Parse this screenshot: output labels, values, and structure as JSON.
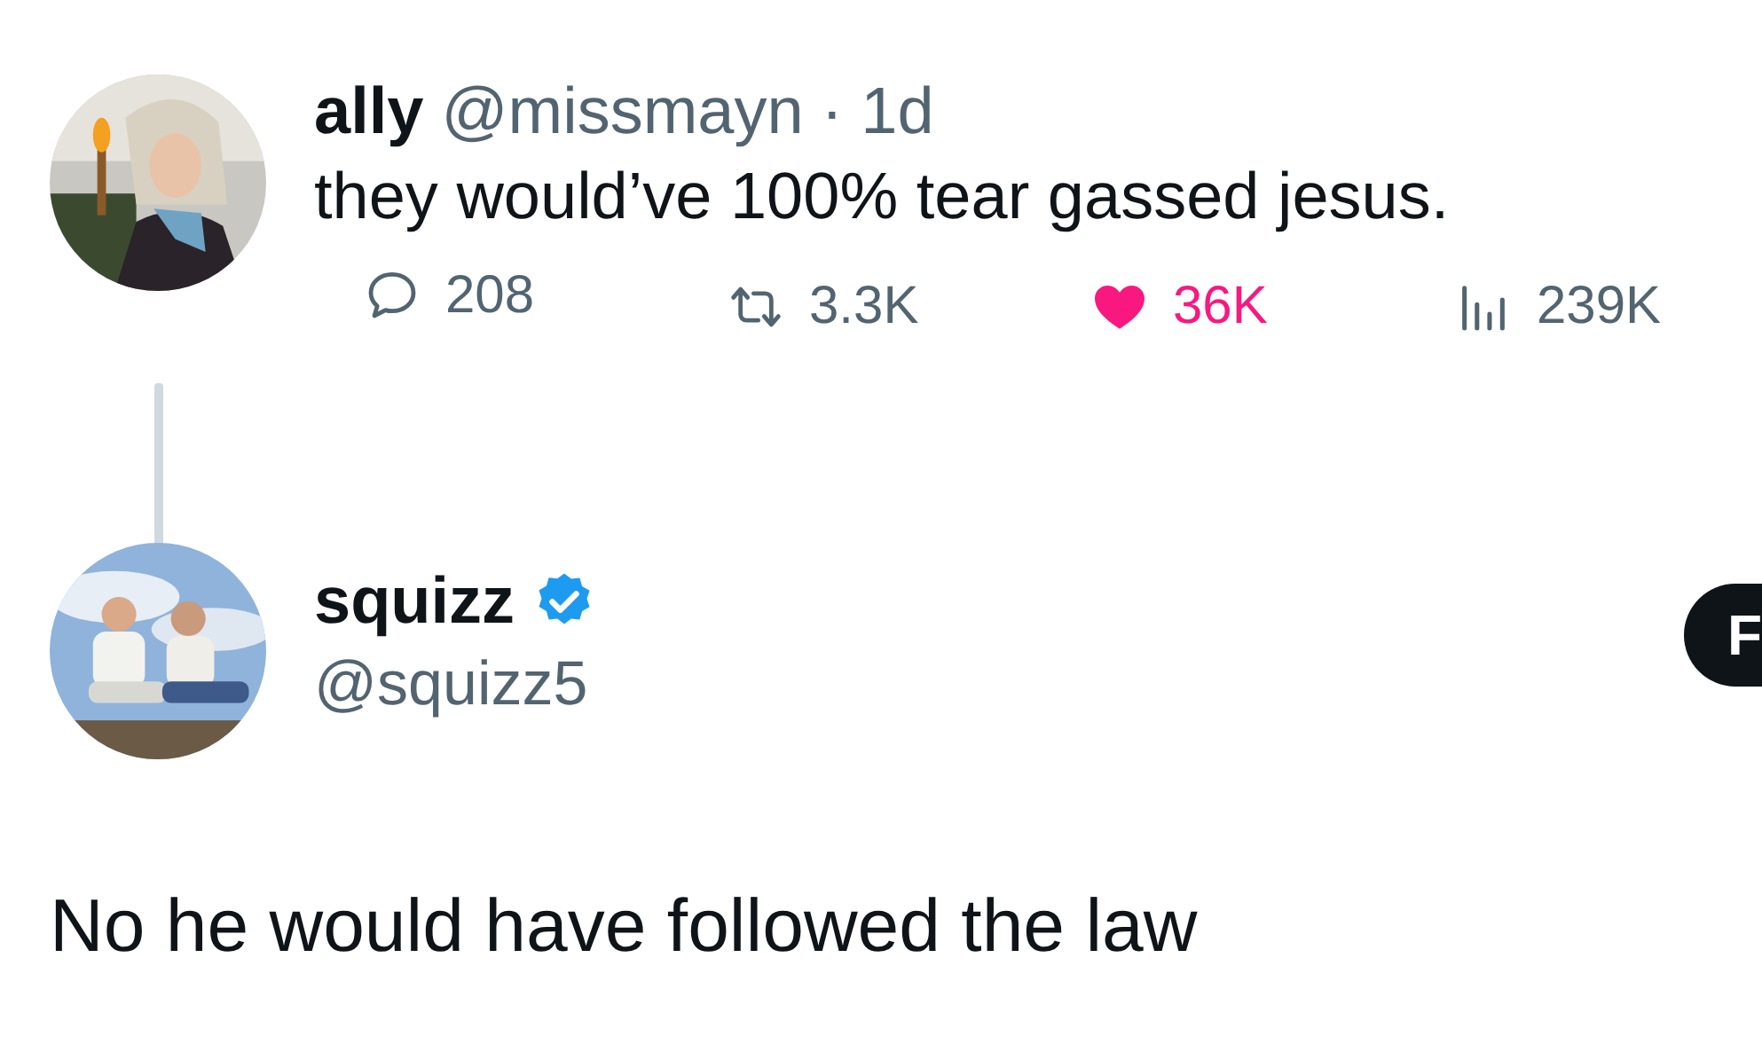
{
  "tweet": {
    "author_name": "ally",
    "handle": "@missmayn",
    "separator": "·",
    "time": "1d",
    "text": "they would’ve 100% tear gassed jesus.",
    "stats": [
      {
        "kind": "reply",
        "count": "208",
        "active": false
      },
      {
        "kind": "retweet",
        "count": "3.3K",
        "active": false
      },
      {
        "kind": "like",
        "count": "36K",
        "active": true
      },
      {
        "kind": "views",
        "count": "239K",
        "active": false
      }
    ]
  },
  "reply": {
    "author_name": "squizz",
    "verified": true,
    "handle": "@squizz5",
    "follow_button": "F",
    "text": "No he would have followed the law"
  }
}
